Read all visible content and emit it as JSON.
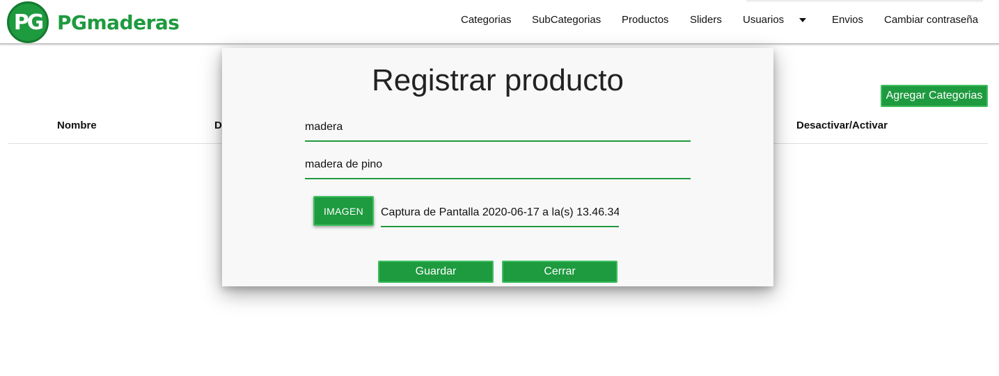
{
  "brand": {
    "logo_text": "PG",
    "name": "PGmaderas"
  },
  "nav": {
    "items": [
      "Categorias",
      "SubCategorias",
      "Productos",
      "Sliders",
      "Usuarios",
      "Envios",
      "Cambiar contraseña"
    ]
  },
  "page": {
    "add_button": "Agregar Categorias",
    "table_headers": [
      "Nombre",
      "D",
      "Desactivar/Activar"
    ]
  },
  "modal": {
    "title": "Registrar producto",
    "name_value": "madera",
    "description_value": "madera de pino",
    "image_button": "IMAGEN",
    "file_name": "Captura de Pantalla 2020-06-17 a la(s) 13.46.34",
    "save_button": "Guardar",
    "close_button": "Cerrar"
  },
  "colors": {
    "primary": "#1e9a3f",
    "button_border": "#3fbf5f",
    "modal_bg": "#f8f8f8"
  },
  "icons": {
    "usuarios_dropdown": "caret-down-icon"
  }
}
